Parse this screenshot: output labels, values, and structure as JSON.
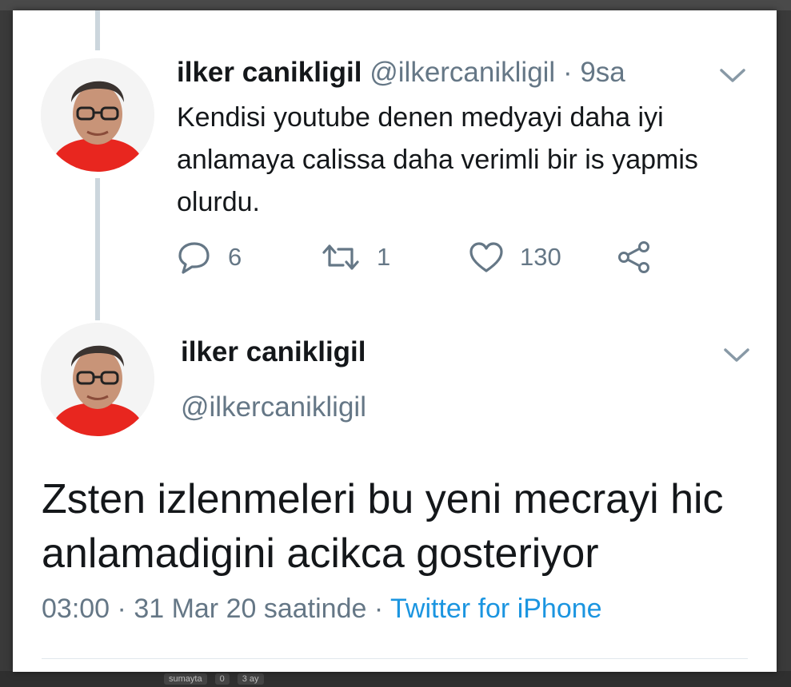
{
  "tweet_reply": {
    "author_name": "ilker canikligil",
    "author_handle": "@ilkercanikligil",
    "separator": " · ",
    "time": "9sa",
    "text": "Kendisi youtube denen medyayi daha iyi anlamaya calissa daha verimli bir is yapmis olurdu.",
    "reply_count": "6",
    "retweet_count": "1",
    "like_count": "130"
  },
  "tweet_main": {
    "author_name": "ilker canikligil",
    "author_handle": "@ilkercanikligil",
    "text": "Zsten izlenmeleri bu yeni mecrayi hic anlamadigini acikca gosteriyor",
    "time": "03:00",
    "date_text": "31 Mar 20 saatinde",
    "meta_separator": " · ",
    "source": "Twitter for iPhone"
  },
  "background": {
    "bottom_user": "sumayta",
    "bottom_comments": "0",
    "bottom_age": "3 ay"
  },
  "colors": {
    "text": "#14171a",
    "secondary": "#657786",
    "link": "#1b95e0",
    "thread_line": "#ccd6dd",
    "avatar_shirt": "#e8261f"
  },
  "icons": [
    "reply-icon",
    "retweet-icon",
    "like-icon",
    "share-icon",
    "chevron-down-icon"
  ]
}
